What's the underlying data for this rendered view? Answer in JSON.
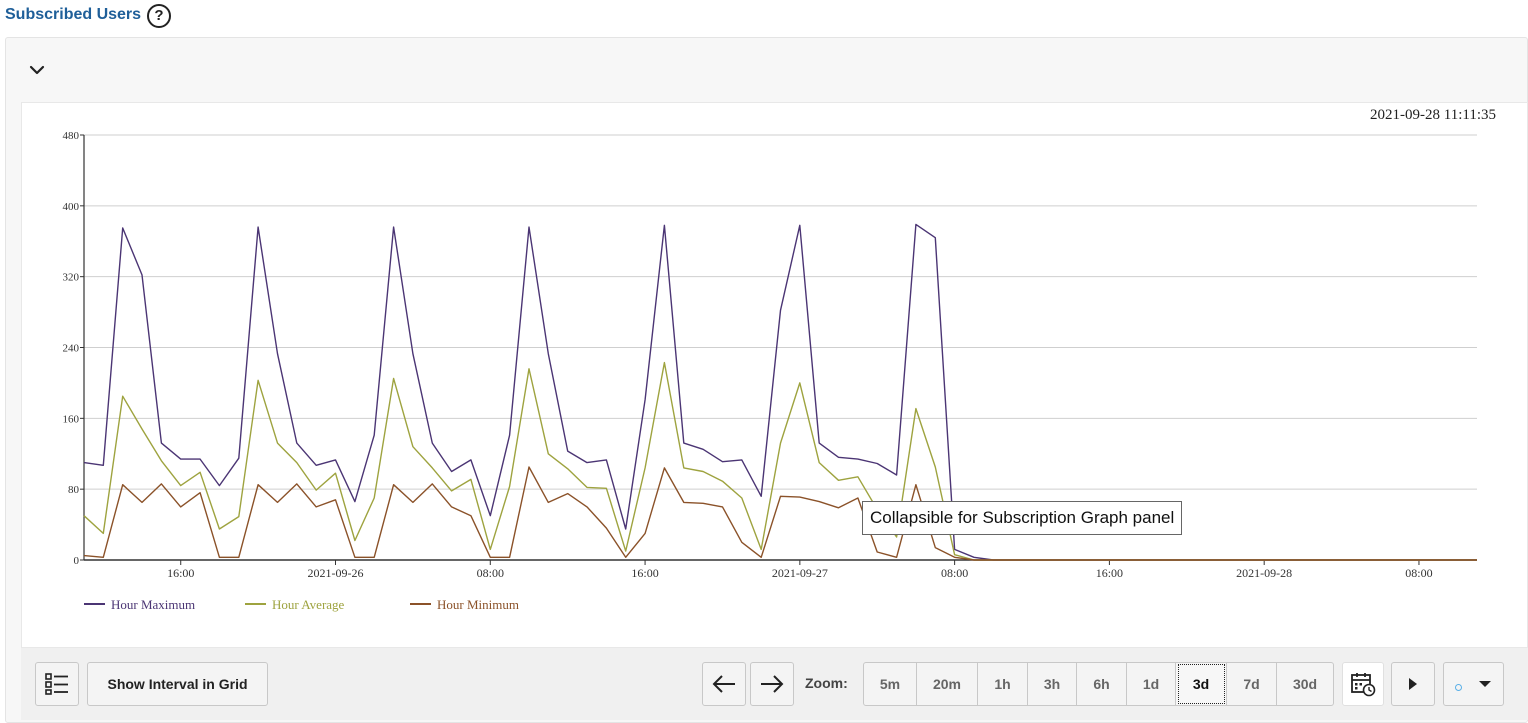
{
  "header": {
    "title": "Subscribed Users",
    "help_icon": "help-icon",
    "help_glyph": "?"
  },
  "panel": {
    "collapse_icon": "chevron-down-icon",
    "timestamp": "2021-09-28 11:11:35"
  },
  "tooltip": {
    "text": "Collapsible for Subscription Graph panel"
  },
  "toolbar": {
    "list_icon": "list-icon",
    "show_interval_label": "Show Interval in Grid",
    "prev_icon": "arrow-left-icon",
    "next_icon": "arrow-right-icon",
    "zoom_label": "Zoom:",
    "zoom_options": [
      "5m",
      "20m",
      "1h",
      "3h",
      "6h",
      "1d",
      "3d",
      "7d",
      "30d"
    ],
    "zoom_selected": "3d",
    "calendar_icon": "calendar-clock-icon",
    "play_icon": "play-icon",
    "dropdown_icon": "caret-down-icon"
  },
  "chart_data": {
    "type": "line",
    "ylim": [
      0,
      480
    ],
    "yticks": [
      0,
      80,
      160,
      240,
      320,
      400,
      480
    ],
    "xlim": [
      "2021-09-25 11:00",
      "2021-09-28 11:00"
    ],
    "xticks": [
      {
        "t": "2021-09-25 16:00",
        "label": "16:00"
      },
      {
        "t": "2021-09-26 00:00",
        "label": "2021-09-26"
      },
      {
        "t": "2021-09-26 08:00",
        "label": "08:00"
      },
      {
        "t": "2021-09-26 16:00",
        "label": "16:00"
      },
      {
        "t": "2021-09-27 00:00",
        "label": "2021-09-27"
      },
      {
        "t": "2021-09-27 08:00",
        "label": "08:00"
      },
      {
        "t": "2021-09-27 16:00",
        "label": "16:00"
      },
      {
        "t": "2021-09-28 00:00",
        "label": "2021-09-28"
      },
      {
        "t": "2021-09-28 08:00",
        "label": "08:00"
      }
    ],
    "grid": true,
    "legend_position": "bottom-left",
    "series": [
      {
        "name": "Hour Maximum",
        "color": "#4b3574",
        "points": [
          [
            "2021-09-25 11:00",
            110
          ],
          [
            "2021-09-25 12:00",
            107
          ],
          [
            "2021-09-25 13:00",
            375
          ],
          [
            "2021-09-25 14:00",
            322
          ],
          [
            "2021-09-25 15:00",
            132
          ],
          [
            "2021-09-25 16:00",
            114
          ],
          [
            "2021-09-25 17:00",
            114
          ],
          [
            "2021-09-25 18:00",
            84
          ],
          [
            "2021-09-25 19:00",
            115
          ],
          [
            "2021-09-25 20:00",
            376
          ],
          [
            "2021-09-25 21:00",
            233
          ],
          [
            "2021-09-25 22:00",
            132
          ],
          [
            "2021-09-25 23:00",
            107
          ],
          [
            "2021-09-26 00:00",
            113
          ],
          [
            "2021-09-26 01:00",
            66
          ],
          [
            "2021-09-26 02:00",
            141
          ],
          [
            "2021-09-26 03:00",
            376
          ],
          [
            "2021-09-26 04:00",
            233
          ],
          [
            "2021-09-26 05:00",
            132
          ],
          [
            "2021-09-26 06:00",
            100
          ],
          [
            "2021-09-26 07:00",
            113
          ],
          [
            "2021-09-26 08:00",
            50
          ],
          [
            "2021-09-26 09:00",
            141
          ],
          [
            "2021-09-26 10:00",
            376
          ],
          [
            "2021-09-26 11:00",
            233
          ],
          [
            "2021-09-26 12:00",
            123
          ],
          [
            "2021-09-26 13:00",
            110
          ],
          [
            "2021-09-26 14:00",
            113
          ],
          [
            "2021-09-26 15:00",
            35
          ],
          [
            "2021-09-26 16:00",
            181
          ],
          [
            "2021-09-26 17:00",
            378
          ],
          [
            "2021-09-26 18:00",
            132
          ],
          [
            "2021-09-26 19:00",
            125
          ],
          [
            "2021-09-26 20:00",
            111
          ],
          [
            "2021-09-26 21:00",
            113
          ],
          [
            "2021-09-26 22:00",
            72
          ],
          [
            "2021-09-26 23:00",
            282
          ],
          [
            "2021-09-27 00:00",
            378
          ],
          [
            "2021-09-27 01:00",
            132
          ],
          [
            "2021-09-27 02:00",
            116
          ],
          [
            "2021-09-27 03:00",
            114
          ],
          [
            "2021-09-27 04:00",
            109
          ],
          [
            "2021-09-27 05:00",
            96
          ],
          [
            "2021-09-27 06:00",
            379
          ],
          [
            "2021-09-27 07:00",
            364
          ],
          [
            "2021-09-27 08:00",
            12
          ],
          [
            "2021-09-27 09:00",
            3
          ],
          [
            "2021-09-27 10:00",
            0
          ],
          [
            "2021-09-28 11:00",
            0
          ]
        ]
      },
      {
        "name": "Hour Average",
        "color": "#9ea33f",
        "points": [
          [
            "2021-09-25 11:00",
            50
          ],
          [
            "2021-09-25 12:00",
            30
          ],
          [
            "2021-09-25 13:00",
            185
          ],
          [
            "2021-09-25 14:00",
            148
          ],
          [
            "2021-09-25 15:00",
            112
          ],
          [
            "2021-09-25 16:00",
            84
          ],
          [
            "2021-09-25 17:00",
            99
          ],
          [
            "2021-09-25 18:00",
            35
          ],
          [
            "2021-09-25 19:00",
            49
          ],
          [
            "2021-09-25 20:00",
            203
          ],
          [
            "2021-09-25 21:00",
            132
          ],
          [
            "2021-09-25 22:00",
            110
          ],
          [
            "2021-09-25 23:00",
            79
          ],
          [
            "2021-09-26 00:00",
            98
          ],
          [
            "2021-09-26 01:00",
            22
          ],
          [
            "2021-09-26 02:00",
            70
          ],
          [
            "2021-09-26 03:00",
            205
          ],
          [
            "2021-09-26 04:00",
            128
          ],
          [
            "2021-09-26 05:00",
            104
          ],
          [
            "2021-09-26 06:00",
            78
          ],
          [
            "2021-09-26 07:00",
            91
          ],
          [
            "2021-09-26 08:00",
            12
          ],
          [
            "2021-09-26 09:00",
            83
          ],
          [
            "2021-09-26 10:00",
            216
          ],
          [
            "2021-09-26 11:00",
            120
          ],
          [
            "2021-09-26 12:00",
            103
          ],
          [
            "2021-09-26 13:00",
            82
          ],
          [
            "2021-09-26 14:00",
            81
          ],
          [
            "2021-09-26 15:00",
            10
          ],
          [
            "2021-09-26 16:00",
            104
          ],
          [
            "2021-09-26 17:00",
            223
          ],
          [
            "2021-09-26 18:00",
            104
          ],
          [
            "2021-09-26 19:00",
            100
          ],
          [
            "2021-09-26 20:00",
            89
          ],
          [
            "2021-09-26 21:00",
            70
          ],
          [
            "2021-09-26 22:00",
            12
          ],
          [
            "2021-09-26 23:00",
            132
          ],
          [
            "2021-09-27 00:00",
            200
          ],
          [
            "2021-09-27 01:00",
            110
          ],
          [
            "2021-09-27 02:00",
            90
          ],
          [
            "2021-09-27 03:00",
            94
          ],
          [
            "2021-09-27 04:00",
            57
          ],
          [
            "2021-09-27 05:00",
            26
          ],
          [
            "2021-09-27 06:00",
            171
          ],
          [
            "2021-09-27 07:00",
            105
          ],
          [
            "2021-09-27 08:00",
            6
          ],
          [
            "2021-09-27 09:00",
            0
          ],
          [
            "2021-09-28 11:00",
            0
          ]
        ]
      },
      {
        "name": "Hour Minimum",
        "color": "#8b5229",
        "points": [
          [
            "2021-09-25 11:00",
            5
          ],
          [
            "2021-09-25 12:00",
            3
          ],
          [
            "2021-09-25 13:00",
            85
          ],
          [
            "2021-09-25 14:00",
            65
          ],
          [
            "2021-09-25 15:00",
            86
          ],
          [
            "2021-09-25 16:00",
            60
          ],
          [
            "2021-09-25 17:00",
            76
          ],
          [
            "2021-09-25 18:00",
            3
          ],
          [
            "2021-09-25 19:00",
            3
          ],
          [
            "2021-09-25 20:00",
            85
          ],
          [
            "2021-09-25 21:00",
            65
          ],
          [
            "2021-09-25 22:00",
            86
          ],
          [
            "2021-09-25 23:00",
            60
          ],
          [
            "2021-09-26 00:00",
            68
          ],
          [
            "2021-09-26 01:00",
            3
          ],
          [
            "2021-09-26 02:00",
            3
          ],
          [
            "2021-09-26 03:00",
            85
          ],
          [
            "2021-09-26 04:00",
            65
          ],
          [
            "2021-09-26 05:00",
            86
          ],
          [
            "2021-09-26 06:00",
            60
          ],
          [
            "2021-09-26 07:00",
            50
          ],
          [
            "2021-09-26 08:00",
            3
          ],
          [
            "2021-09-26 09:00",
            3
          ],
          [
            "2021-09-26 10:00",
            105
          ],
          [
            "2021-09-26 11:00",
            65
          ],
          [
            "2021-09-26 12:00",
            75
          ],
          [
            "2021-09-26 13:00",
            60
          ],
          [
            "2021-09-26 14:00",
            36
          ],
          [
            "2021-09-26 15:00",
            3
          ],
          [
            "2021-09-26 16:00",
            30
          ],
          [
            "2021-09-26 17:00",
            104
          ],
          [
            "2021-09-26 18:00",
            65
          ],
          [
            "2021-09-26 19:00",
            64
          ],
          [
            "2021-09-26 20:00",
            60
          ],
          [
            "2021-09-26 21:00",
            20
          ],
          [
            "2021-09-26 22:00",
            3
          ],
          [
            "2021-09-26 23:00",
            72
          ],
          [
            "2021-09-27 00:00",
            71
          ],
          [
            "2021-09-27 01:00",
            66
          ],
          [
            "2021-09-27 02:00",
            59
          ],
          [
            "2021-09-27 03:00",
            70
          ],
          [
            "2021-09-27 04:00",
            9
          ],
          [
            "2021-09-27 05:00",
            3
          ],
          [
            "2021-09-27 06:00",
            85
          ],
          [
            "2021-09-27 07:00",
            14
          ],
          [
            "2021-09-27 08:00",
            3
          ],
          [
            "2021-09-27 09:00",
            0
          ],
          [
            "2021-09-28 11:00",
            0
          ]
        ]
      }
    ]
  }
}
